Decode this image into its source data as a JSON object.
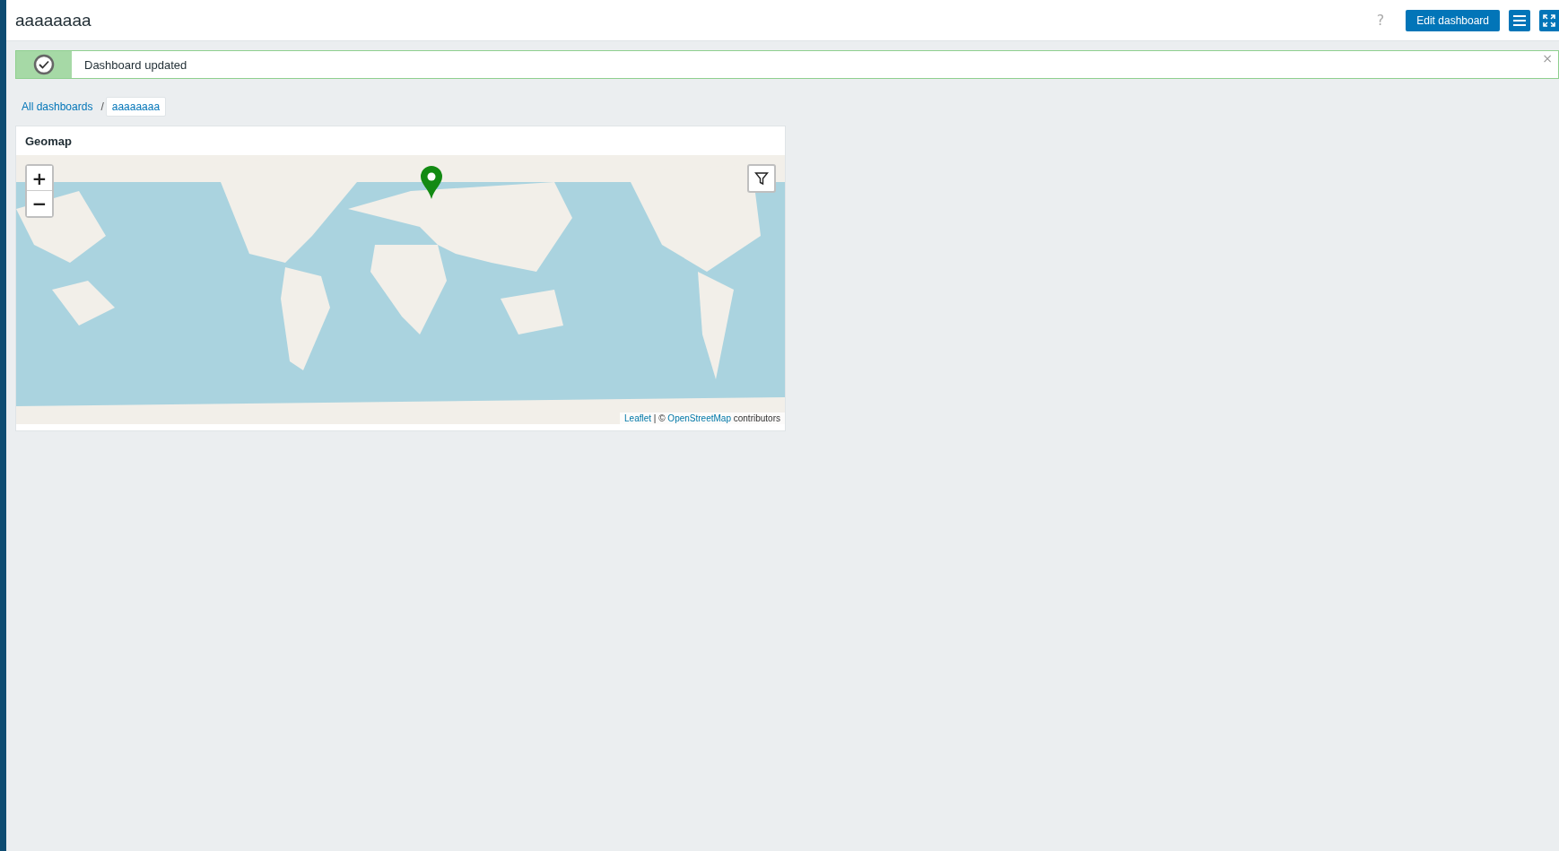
{
  "header": {
    "title": "aaaaaaaa",
    "help": "?",
    "edit_button": "Edit dashboard"
  },
  "message": {
    "kind": "success",
    "text": "Dashboard updated",
    "close": "×"
  },
  "breadcrumb": [
    {
      "label": "All dashboards",
      "selected": false
    },
    {
      "label": "aaaaaaaa",
      "selected": true
    }
  ],
  "breadcrumb_separator": "/",
  "widget": {
    "title": "Geomap",
    "map": {
      "kind": "picture",
      "zoom_in": "+",
      "zoom_out": "−",
      "attribution": [
        {
          "kind": "link",
          "text": "Leaflet"
        },
        {
          "kind": "text",
          "text": " | © "
        },
        {
          "kind": "link",
          "text": "OpenStreetMap"
        },
        {
          "kind": "text",
          "text": " contributors"
        }
      ]
    }
  }
}
